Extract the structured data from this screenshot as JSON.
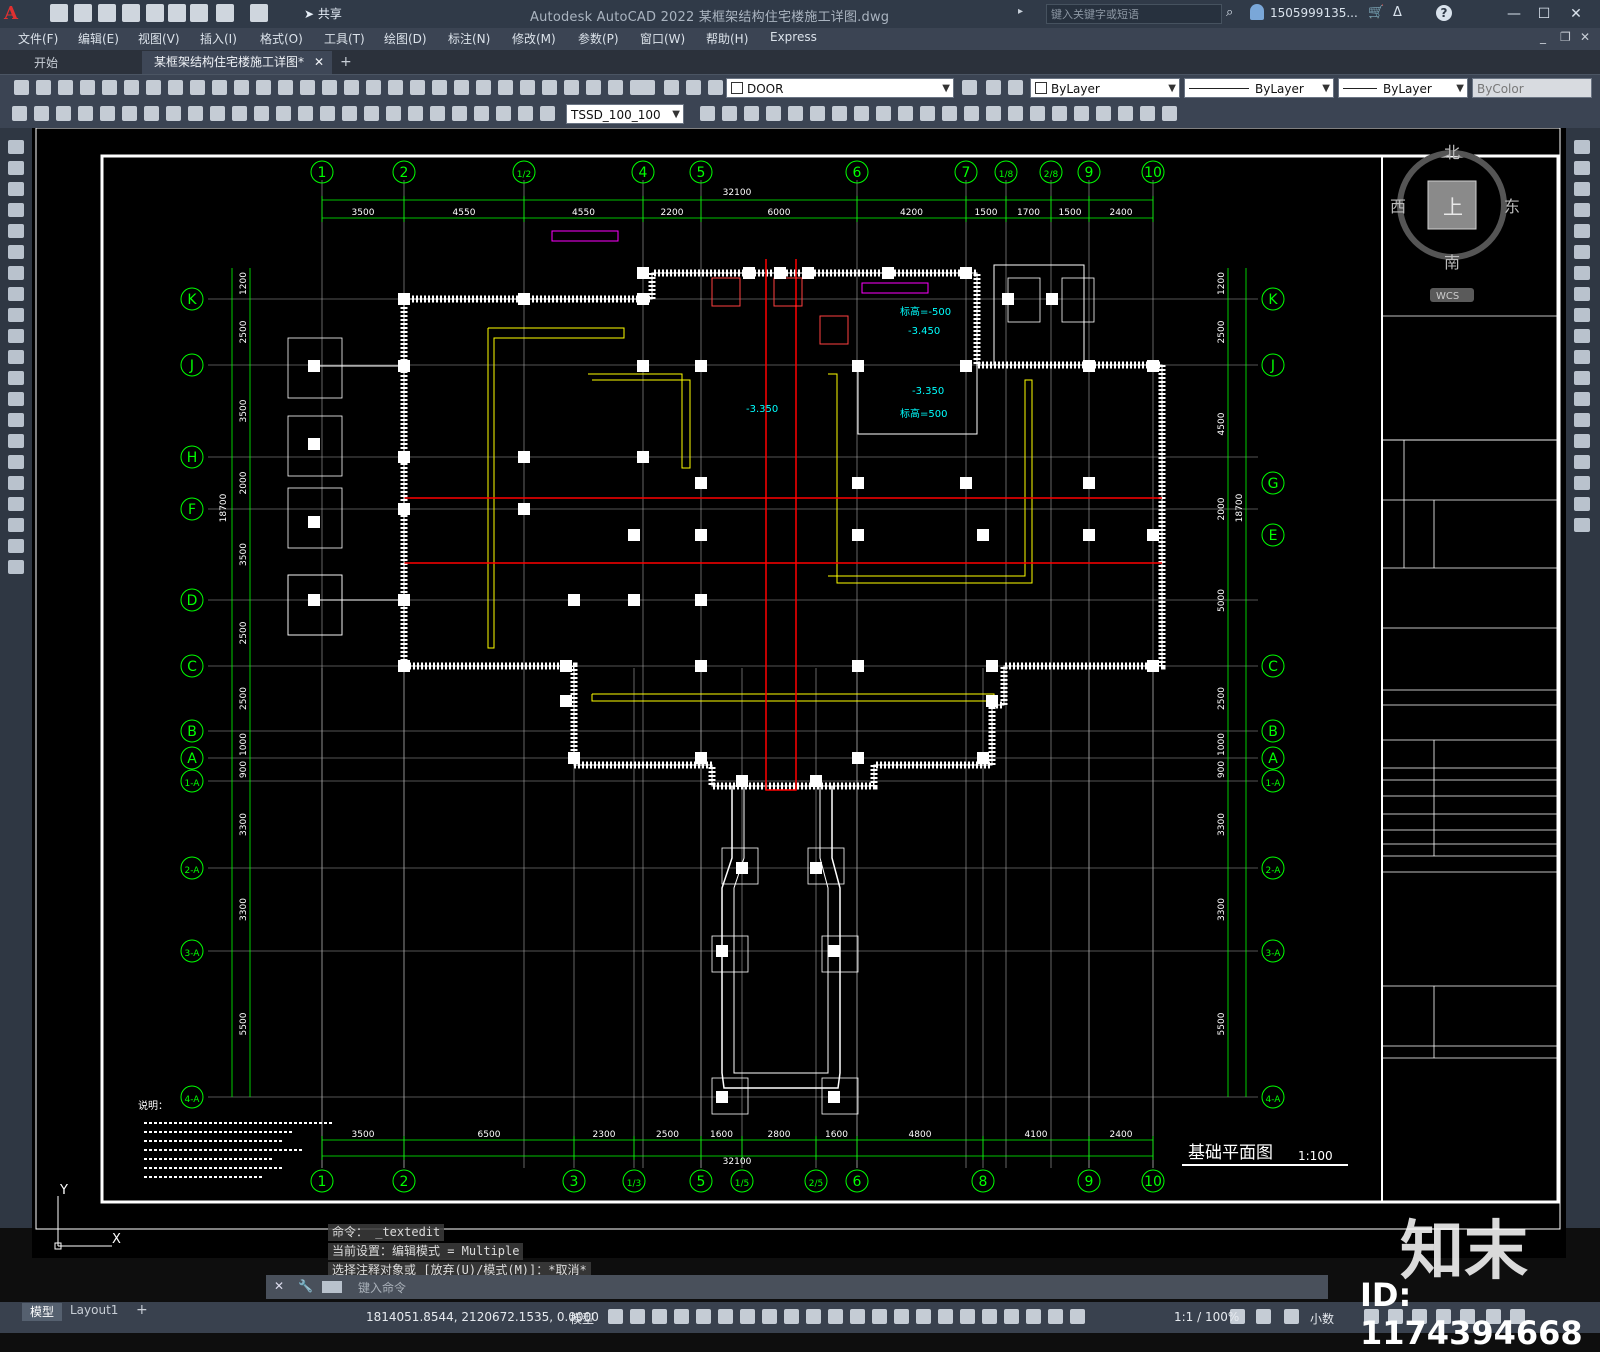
{
  "app": {
    "title": "Autodesk AutoCAD 2022    某框架结构住宅楼施工详图.dwg",
    "share_label": "共享",
    "search_placeholder": "键入关键字或短语",
    "user": "1505999135...",
    "window_controls": [
      "minimize-icon",
      "maximize-icon",
      "close-icon"
    ]
  },
  "menu": [
    "文件(F)",
    "编辑(E)",
    "视图(V)",
    "插入(I)",
    "格式(O)",
    "工具(T)",
    "绘图(D)",
    "标注(N)",
    "修改(M)",
    "参数(P)",
    "窗口(W)",
    "帮助(H)",
    "Express"
  ],
  "tabs": {
    "start": "开始",
    "document": "某框架结构住宅楼施工详图*",
    "add": "+"
  },
  "toolbar": {
    "layer": "DOOR",
    "text_style": "TSSD_100_100",
    "color": "ByLayer",
    "linetype": "ByLayer",
    "lineweight": "ByLayer",
    "plotstyle": "ByColor"
  },
  "viewcube": {
    "north": "北",
    "south": "南",
    "east": "东",
    "west": "西",
    "top": "上",
    "wcs": "WCS"
  },
  "drawing": {
    "title": "基础平面图",
    "scale": "1:100",
    "top_axes": [
      "1",
      "2",
      "1/2",
      "4",
      "5",
      "6",
      "7",
      "1/8",
      "2/8",
      "9",
      "10"
    ],
    "bottom_axes": [
      "1",
      "2",
      "3",
      "1/3",
      "5",
      "1/5",
      "2/5",
      "6",
      "8",
      "9",
      "10"
    ],
    "left_axes": [
      "K",
      "J",
      "H",
      "F",
      "D",
      "C",
      "B",
      "A",
      "1-A",
      "2-A",
      "3-A",
      "4-A"
    ],
    "right_axes": [
      "K",
      "J",
      "G",
      "E",
      "C",
      "B",
      "A",
      "1-A",
      "2-A",
      "3-A",
      "4-A"
    ],
    "top_overall": "32100",
    "top_dims": [
      "3500",
      "4550",
      "4550",
      "2200",
      "6000",
      "4200",
      "1500",
      "1700",
      "1500",
      "2400"
    ],
    "bottom_overall": "32100",
    "bottom_dims": [
      "3500",
      "6500",
      "2300",
      "2500",
      "1600",
      "2800",
      "1600",
      "4800",
      "4100",
      "2400"
    ],
    "left_overall": "18700",
    "left_dims": [
      "1200",
      "2500",
      "3500",
      "2000",
      "3500",
      "2500",
      "2500",
      "1000",
      "900",
      "3300",
      "3300",
      "5500"
    ],
    "right_overall": "18700",
    "right_dims": [
      "1200",
      "2500",
      "4500",
      "2000",
      "5000",
      "2500",
      "1000",
      "900",
      "3300",
      "3300",
      "5500"
    ],
    "level_labels": [
      "-3.350",
      "-3.450",
      "-3.350"
    ],
    "elevation_labels": [
      "标高=-500",
      "标高=500"
    ],
    "notes_title": "说明："
  },
  "command": {
    "line1": "命令： _textedit",
    "line2": "当前设置：编辑模式 = Multiple",
    "line3": "选择注释对象或 [放弃(U)/模式(M)]：*取消*",
    "input_placeholder": "键入命令"
  },
  "status": {
    "model_tab": "模型",
    "layout_tab": "Layout1",
    "coords": "1814051.8544, 2120672.1535, 0.0000",
    "space": "模型",
    "scale": "1:1 / 100%",
    "units": "小数"
  },
  "watermark": {
    "logo": "知末",
    "id": "ID: 1174394668"
  },
  "colors": {
    "axis": "#00ff00",
    "wall": "#ffffff",
    "beam": "#ffff00",
    "red_line": "#ff0000",
    "magenta": "#ff00ff",
    "cyan": "#00ffff"
  }
}
